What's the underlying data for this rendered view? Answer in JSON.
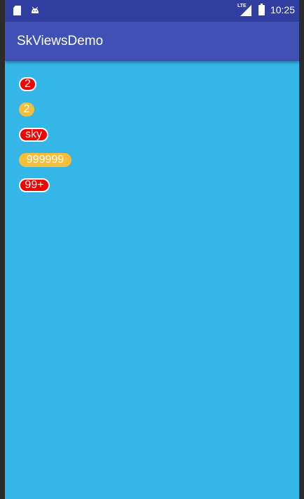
{
  "status_bar": {
    "time": "10:25",
    "network_label": "LTE",
    "left_icons": [
      "sd-card-icon",
      "android-icon"
    ],
    "right_icons": [
      "lte-signal-icon",
      "battery-icon"
    ]
  },
  "app_bar": {
    "title": "SkViewsDemo",
    "background": "#3f51b5"
  },
  "content": {
    "background": "#34b6e6",
    "badges": [
      {
        "text": "2",
        "style": "red"
      },
      {
        "text": "2",
        "style": "yellow"
      },
      {
        "text": "sky",
        "style": "red"
      },
      {
        "text": "999999",
        "style": "yellow"
      },
      {
        "text": "99+",
        "style": "red"
      }
    ]
  },
  "colors": {
    "badge_red": "#f50000",
    "badge_yellow": "#f6be3a",
    "status_bar": "#303f9f"
  }
}
